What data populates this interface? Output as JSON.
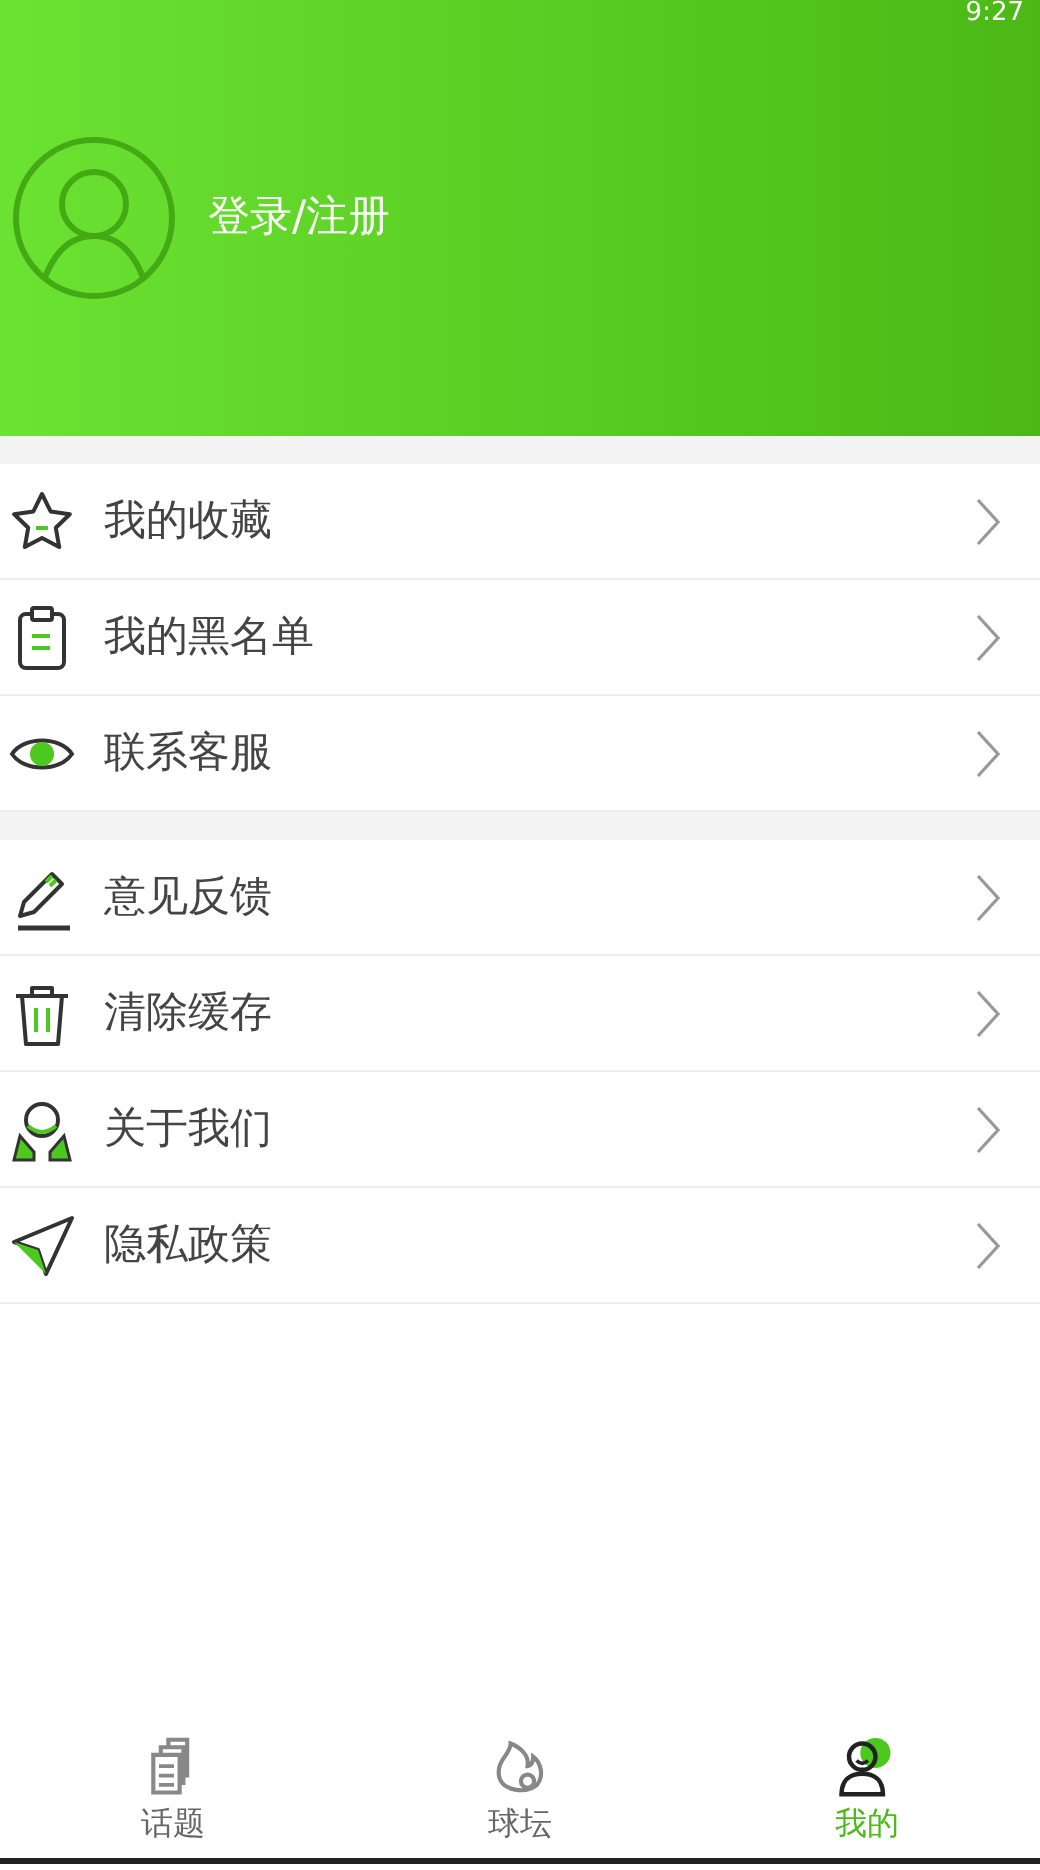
{
  "status_bar": {
    "time": "9:27"
  },
  "header": {
    "login_label": "登录/注册"
  },
  "menu_groups": [
    {
      "items": [
        {
          "label": "我的收藏",
          "kind": "star"
        },
        {
          "label": "我的黑名单",
          "kind": "clipboard"
        },
        {
          "label": "联系客服",
          "kind": "eye"
        }
      ]
    },
    {
      "items": [
        {
          "label": "意见反馈",
          "kind": "pencil"
        },
        {
          "label": "清除缓存",
          "kind": "trash"
        },
        {
          "label": "关于我们",
          "kind": "people"
        },
        {
          "label": "隐私政策",
          "kind": "plane"
        }
      ]
    }
  ],
  "tab_bar": [
    {
      "label": "话题",
      "kind": "doc",
      "selected": false
    },
    {
      "label": "球坛",
      "kind": "flame",
      "selected": false
    },
    {
      "label": "我的",
      "kind": "user",
      "selected": true
    }
  ]
}
